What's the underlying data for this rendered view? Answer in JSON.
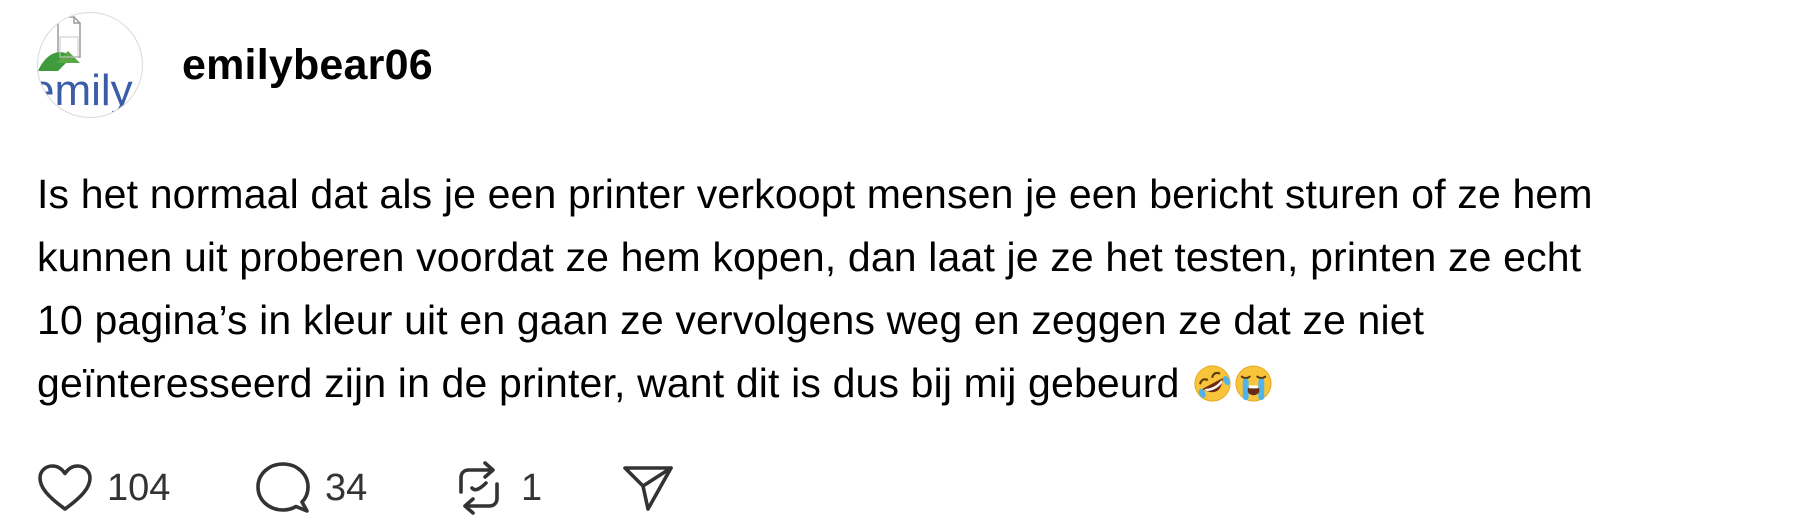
{
  "post": {
    "avatar": {
      "alt_text": "emily",
      "accent_color": "#3b5ca8"
    },
    "username": "emilybear06",
    "text": "Is het normaal dat als je een printer verkoopt mensen je een bericht sturen of ze hem\nkunnen uit proberen voordat ze hem kopen, dan laat je ze het testen, printen ze echt\n10 pagina’s in kleur uit en gaan ze vervolgens weg en zeggen ze dat ze niet\ngeïnteresseerd zijn in de printer, want dit is dus bij mij gebeurd",
    "emojis": [
      "rofl-emoji",
      "loudly-crying-emoji"
    ],
    "actions": {
      "like": {
        "icon": "heart-icon",
        "count": "104"
      },
      "comment": {
        "icon": "speech-bubble-icon",
        "count": "34"
      },
      "repost": {
        "icon": "repost-icon",
        "count": "1"
      },
      "share": {
        "icon": "send-icon"
      }
    }
  }
}
